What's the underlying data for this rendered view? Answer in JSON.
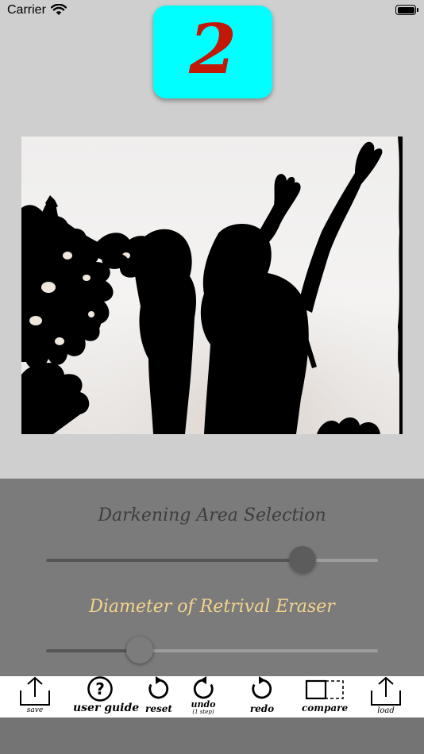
{
  "status_bar": {
    "carrier": "Carrier"
  },
  "step_badge": {
    "number": "2",
    "background": "#00ffff",
    "text_color": "#c21808"
  },
  "controls": {
    "darkening": {
      "label": "Darkening Area Selection",
      "value_fraction": 0.76
    },
    "eraser": {
      "label": "Diameter of Retrival Eraser",
      "value_fraction": 0.28,
      "label_color": "#f3d38b"
    }
  },
  "toolbar": {
    "save": "save",
    "user_guide": "user guide",
    "reset": "reset",
    "undo": "undo",
    "undo_sub": "(1 step)",
    "redo": "redo",
    "compare": "compare",
    "load": "load"
  }
}
